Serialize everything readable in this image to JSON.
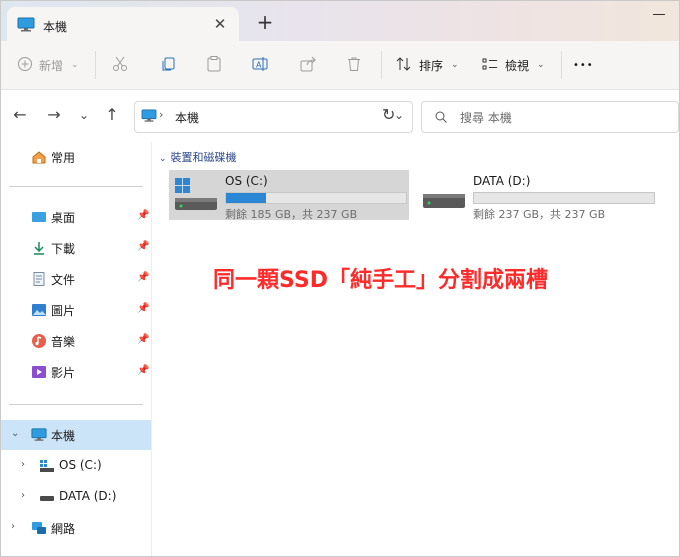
{
  "tab": {
    "title": "本機",
    "close": "✕",
    "new_tab": "+"
  },
  "toolbar": {
    "new_label": "新增",
    "sort_label": "排序",
    "view_label": "檢視",
    "more_label": "•••"
  },
  "address": {
    "path": "本機",
    "arrow": "›"
  },
  "search": {
    "placeholder": "搜尋 本機"
  },
  "sidebar": {
    "home": "常用",
    "quick": [
      {
        "label": "桌面"
      },
      {
        "label": "下載"
      },
      {
        "label": "文件"
      },
      {
        "label": "圖片"
      },
      {
        "label": "音樂"
      },
      {
        "label": "影片"
      }
    ],
    "thispc": "本機",
    "drives": [
      {
        "label": "OS (C:)"
      },
      {
        "label": "DATA (D:)"
      }
    ],
    "network": "網路"
  },
  "main": {
    "group_label": "裝置和磁碟機",
    "drives": [
      {
        "name": "OS (C:)",
        "free_text": "剩餘 185 GB，共 237 GB",
        "used_fraction": 0.22
      },
      {
        "name": "DATA (D:)",
        "free_text": "剩餘 237 GB，共 237 GB",
        "used_fraction": 0.0
      }
    ],
    "annotation": "同一顆SSD「純手工」分割成兩槽"
  },
  "colors": {
    "accent": "#2b86d6",
    "annotation": "#ff2a2a",
    "selection": "#cce4f7"
  }
}
